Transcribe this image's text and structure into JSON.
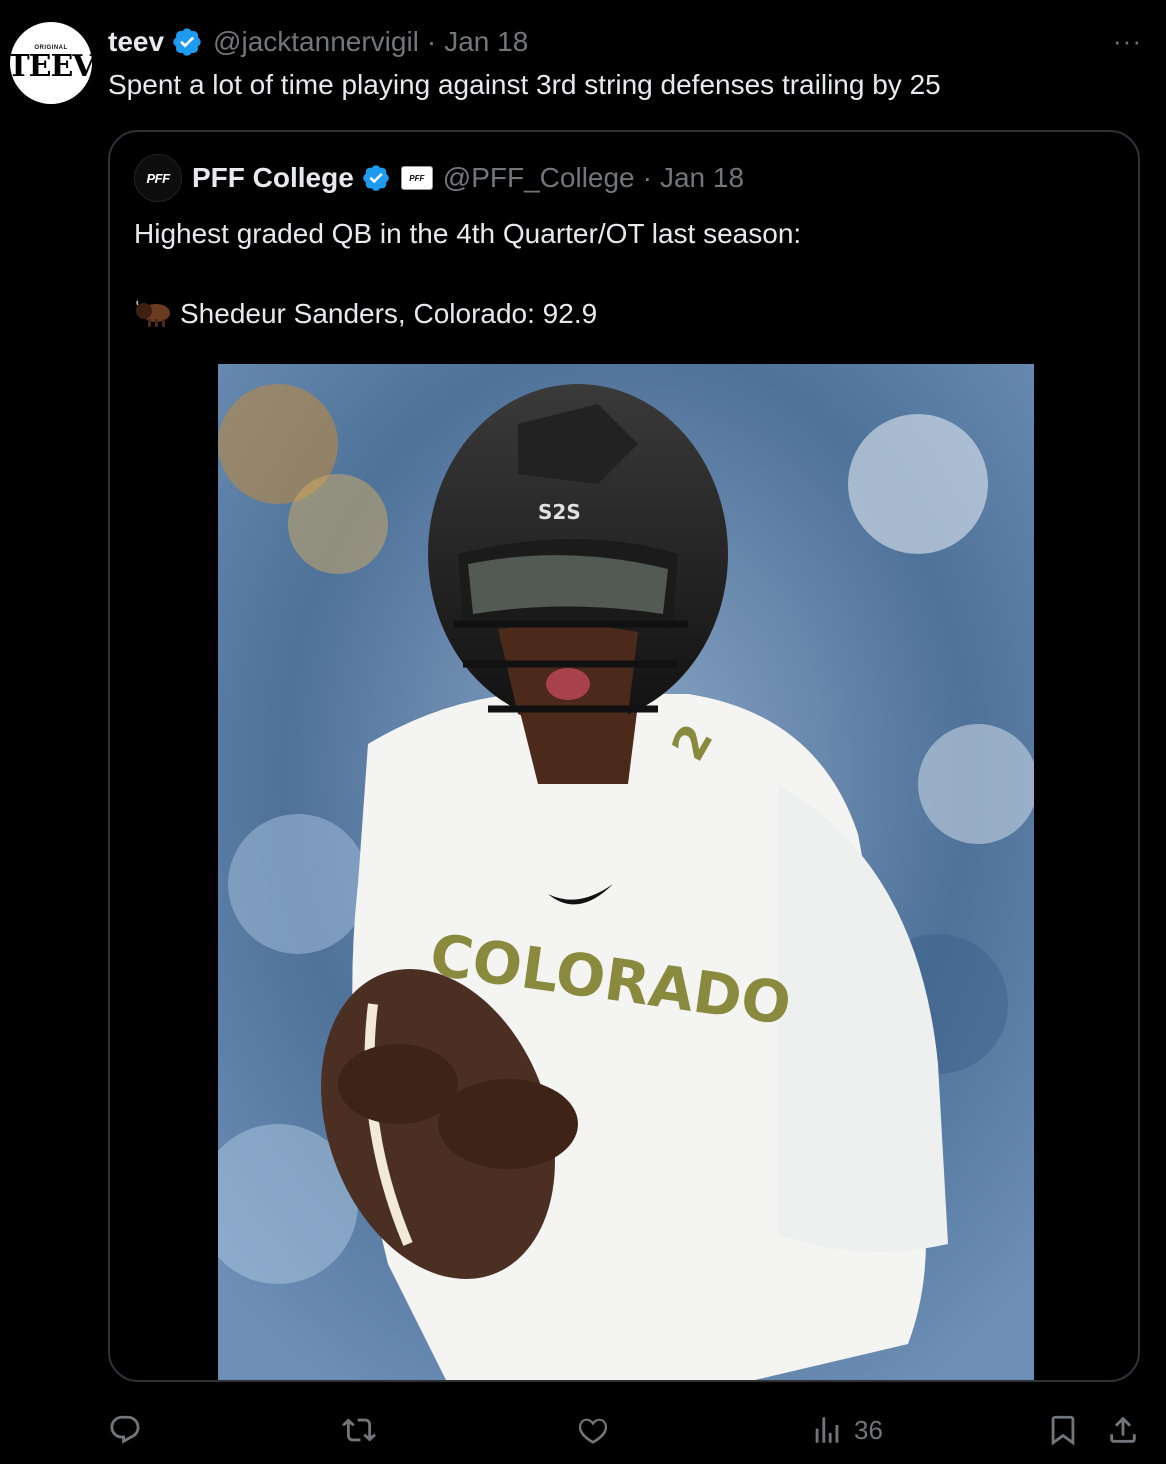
{
  "tweet": {
    "avatar_small_text": "ORIGINAL",
    "avatar_logo_text": "TEEV",
    "display_name": "teev",
    "handle": "@jacktannervigil",
    "separator": "·",
    "date": "Jan 18",
    "more_label": "···",
    "text": "Spent a lot of time playing against 3rd string defenses trailing by 25"
  },
  "quote": {
    "avatar_text": "PFF",
    "display_name": "PFF College",
    "badge_text": "PFF",
    "handle": "@PFF_College",
    "separator": "·",
    "date": "Jan 18",
    "text_line1": "Highest graded QB in the 4th Quarter/OT last season:",
    "text_line2": "Shedeur Sanders, Colorado: 92.9",
    "photo": {
      "helmet_text": "S2S",
      "jersey_text": "COLORADO",
      "jersey_number": "2"
    }
  },
  "actions": {
    "reply_count": "",
    "repost_count": "",
    "like_count": "",
    "views_count": "36"
  },
  "colors": {
    "background": "#000000",
    "text_primary": "#e7e9ea",
    "text_secondary": "#71767b",
    "verified_blue": "#1d9bf0",
    "border": "#2f3336"
  }
}
